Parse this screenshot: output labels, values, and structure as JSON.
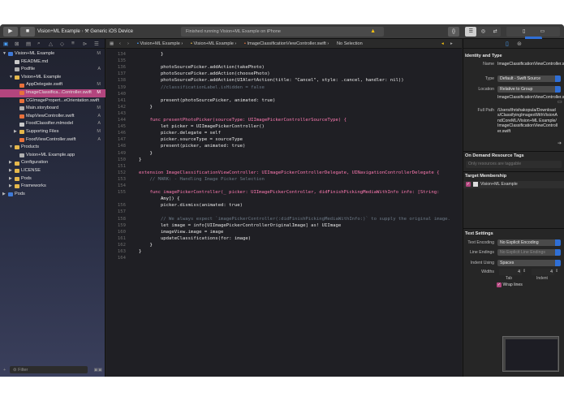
{
  "toolbar": {
    "play_icon": "play-icon",
    "stop_icon": "stop-icon",
    "scheme_target": "Vision+ML Example",
    "scheme_device": "Generic iOS Device",
    "activity_text": "Finished running Vision+ML Example on iPhone"
  },
  "navigator": {
    "items": [
      {
        "label": "Vision+ML Example",
        "status": "M",
        "icon": "project-icon"
      },
      {
        "label": "README.md",
        "status": "",
        "icon": "markdown-icon"
      },
      {
        "label": "Podfile",
        "status": "A",
        "icon": "file-icon"
      },
      {
        "label": "Vision+ML Example",
        "status": "",
        "icon": "folder-icon"
      },
      {
        "label": "AppDelegate.swift",
        "status": "M",
        "icon": "swift-file-icon"
      },
      {
        "label": "ImageClassifica...Controller.swift",
        "status": "M",
        "icon": "swift-file-icon"
      },
      {
        "label": "CGImagePropert...eOrientation.swift",
        "status": "",
        "icon": "swift-file-icon"
      },
      {
        "label": "Main.storyboard",
        "status": "M",
        "icon": "storyboard-icon"
      },
      {
        "label": "MapViewController.swift",
        "status": "A",
        "icon": "swift-file-icon"
      },
      {
        "label": "FoodClassifier.mlmodel",
        "status": "A",
        "icon": "mlmodel-icon"
      },
      {
        "label": "Supporting Files",
        "status": "M",
        "icon": "folder-icon"
      },
      {
        "label": "FoodViewController.swift",
        "status": "A",
        "icon": "swift-file-icon"
      },
      {
        "label": "Products",
        "status": "",
        "icon": "folder-icon"
      },
      {
        "label": "Vision+ML Example.app",
        "status": "",
        "icon": "app-icon"
      },
      {
        "label": "Configuration",
        "status": "",
        "icon": "folder-icon"
      },
      {
        "label": "LICENSE",
        "status": "",
        "icon": "folder-icon"
      },
      {
        "label": "Pods",
        "status": "",
        "icon": "folder-icon"
      },
      {
        "label": "Frameworks",
        "status": "",
        "icon": "folder-icon"
      },
      {
        "label": "Pods",
        "status": "",
        "icon": "project-icon"
      }
    ],
    "filter_placeholder": "Filter"
  },
  "jumpbar": {
    "crumbs": [
      "Vision+ML Example",
      "Vision+ML Example",
      "ImageClassificationViewController.swift",
      "No Selection"
    ]
  },
  "code": {
    "lines": [
      {
        "n": "134",
        "t": "        }"
      },
      {
        "n": "135",
        "t": ""
      },
      {
        "n": "136",
        "t": "        photoSourcePicker.addAction(takePhoto)"
      },
      {
        "n": "137",
        "t": "        photoSourcePicker.addAction(choosePhoto)"
      },
      {
        "n": "138",
        "t": "        photoSourcePicker.addAction(UIAlertAction(title: \"Cancel\", style: .cancel, handler: nil))"
      },
      {
        "n": "139",
        "t": "        //classificationLabel.isHidden = false"
      },
      {
        "n": "140",
        "t": ""
      },
      {
        "n": "141",
        "t": "        present(photoSourcePicker, animated: true)"
      },
      {
        "n": "142",
        "t": "    }"
      },
      {
        "n": "143",
        "t": ""
      },
      {
        "n": "144",
        "t": "    func presentPhotoPicker(sourceType: UIImagePickerControllerSourceType) {"
      },
      {
        "n": "145",
        "t": "        let picker = UIImagePickerController()"
      },
      {
        "n": "146",
        "t": "        picker.delegate = self"
      },
      {
        "n": "147",
        "t": "        picker.sourceType = sourceType"
      },
      {
        "n": "148",
        "t": "        present(picker, animated: true)"
      },
      {
        "n": "149",
        "t": "    }"
      },
      {
        "n": "150",
        "t": "}"
      },
      {
        "n": "151",
        "t": ""
      },
      {
        "n": "152",
        "t": "extension ImageClassificationViewController: UIImagePickerControllerDelegate, UINavigationControllerDelegate {"
      },
      {
        "n": "153",
        "t": "    // MARK: - Handling Image Picker Selection"
      },
      {
        "n": "154",
        "t": ""
      },
      {
        "n": "155",
        "t": "    func imagePickerController(_ picker: UIImagePickerController, didFinishPickingMediaWithInfo info: [String:"
      },
      {
        "n": "",
        "t": "        Any]) {"
      },
      {
        "n": "156",
        "t": "        picker.dismiss(animated: true)"
      },
      {
        "n": "157",
        "t": ""
      },
      {
        "n": "158",
        "t": "        // We always expect `imagePickerController(:didFinishPickingMediaWithInfo:)` to supply the original image."
      },
      {
        "n": "159",
        "t": "        let image = info[UIImagePickerControllerOriginalImage] as! UIImage"
      },
      {
        "n": "160",
        "t": "        imageView.image = image"
      },
      {
        "n": "161",
        "t": "        updateClassifications(for: image)"
      },
      {
        "n": "162",
        "t": "    }"
      },
      {
        "n": "163",
        "t": "}"
      },
      {
        "n": "164",
        "t": ""
      }
    ]
  },
  "inspector": {
    "identity_title": "Identity and Type",
    "name_label": "Name",
    "name_value": "ImageClassificationViewController.swift",
    "type_label": "Type",
    "type_value": "Default - Swift Source",
    "location_label": "Location",
    "location_value": "Relative to Group",
    "location_file": "ImageClassificationViewController.swift",
    "fullpath_label": "Full Path",
    "fullpath_value": "/Users/thrishakopula/Downloads/ClassifyingImagesWithVisionAndCoreML/Vision+ML Example/ImageClassificationViewController.swift",
    "odr_title": "On Demand Resource Tags",
    "odr_placeholder": "Only resources are taggable",
    "target_title": "Target Membership",
    "target_value": "Vision+ML Example",
    "text_title": "Text Settings",
    "encoding_label": "Text Encoding",
    "encoding_value": "No Explicit Encoding",
    "endings_label": "Line Endings",
    "endings_value": "No Explicit Line Endings",
    "indent_label": "Indent Using",
    "indent_value": "Spaces",
    "widths_label": "Widths",
    "tab_value": "4",
    "indent_width_value": "4",
    "tab_label": "Tab",
    "indent_width_label": "Indent",
    "wrap_label": "Wrap lines"
  }
}
